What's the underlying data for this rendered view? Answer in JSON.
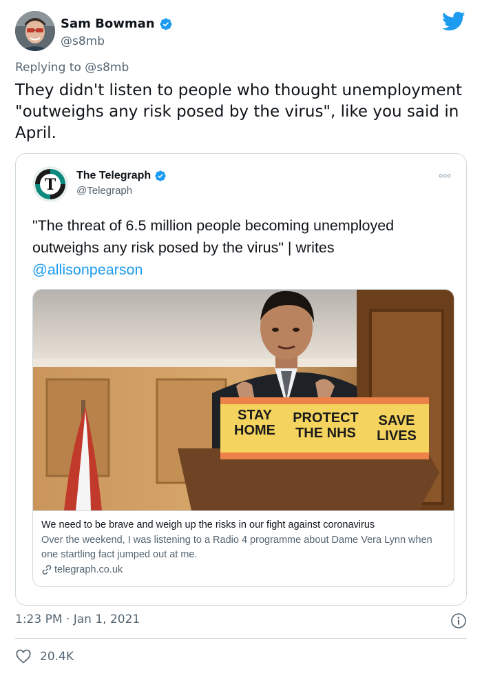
{
  "tweet": {
    "author_name": "Sam Bowman",
    "author_handle": "@s8mb",
    "replying_prefix": "Replying to",
    "replying_handle": "@s8mb",
    "text": "They didn't listen to people who thought unemployment \"outweighs any risk posed by the virus\", like you said in April.",
    "timestamp": "1:23 PM · Jan 1, 2021",
    "likes": "20.4K"
  },
  "quoted": {
    "author_name": "The Telegraph",
    "author_handle": "@Telegraph",
    "text": "\"The threat of 6.5 million people becoming unemployed outweighs any risk posed by the virus\" | writes",
    "mention": "@allisonpearson",
    "card": {
      "podium_left": "STAY HOME",
      "podium_mid": "PROTECT THE NHS",
      "podium_right": "SAVE LIVES",
      "title": "We need to be brave and weigh up the risks in our fight against coronavirus",
      "description": "Over the weekend, I was listening to a Radio 4 programme about Dame Vera Lynn when one startling fact jumped out at me.",
      "domain": "telegraph.co.uk"
    }
  },
  "colors": {
    "accent": "#1d9bf0",
    "secondary_text": "#536471",
    "border": "#cfd9de"
  },
  "icons": [
    "verified-badge-icon",
    "twitter-bird-icon",
    "more-icon",
    "link-icon",
    "info-icon",
    "heart-icon"
  ]
}
